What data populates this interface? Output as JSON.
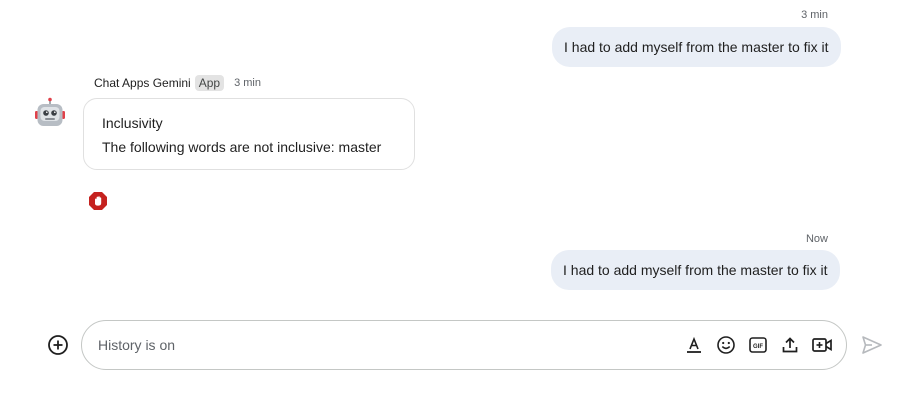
{
  "messages": [
    {
      "time": "3 min",
      "text": "I had to add myself from the master to fix it"
    },
    {
      "time": "Now",
      "text": "I had to add myself from the master to fix it"
    }
  ],
  "bot_message": {
    "sender": "Chat Apps Gemini",
    "badge": "App",
    "time": "3 min",
    "card_title": "Inclusivity",
    "card_body": "The following words are not inclusive: master",
    "reaction_icon": "stop-hand-icon"
  },
  "composer": {
    "placeholder": "History is on",
    "value": "",
    "tools": [
      "format-text-icon",
      "emoji-icon",
      "gif-icon",
      "upload-icon",
      "video-icon"
    ],
    "send_icon": "send-icon",
    "add_icon": "add-circle-icon"
  },
  "colors": {
    "outgoing_bubble": "#e9eef6",
    "card_border": "#e0e0e0",
    "reaction_red": "#c5221f"
  }
}
